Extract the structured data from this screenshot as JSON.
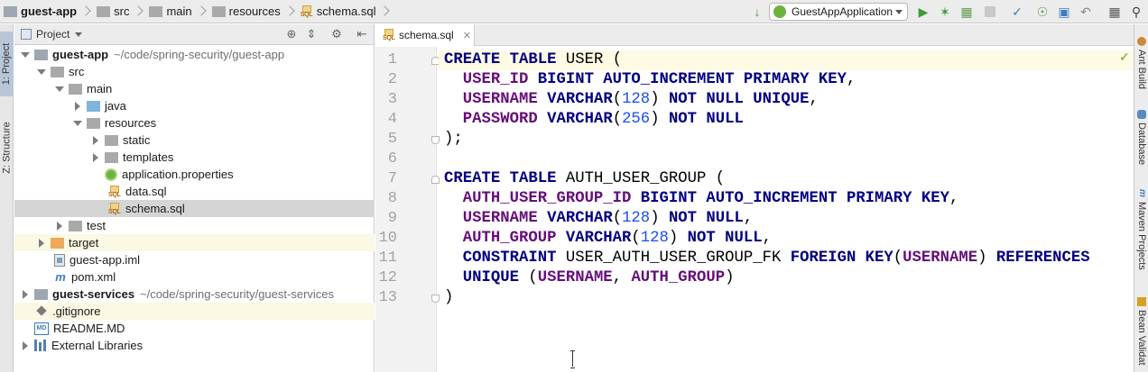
{
  "breadcrumb": {
    "items": [
      {
        "label": "guest-app",
        "icon": "module-folder-icon",
        "bold": true
      },
      {
        "label": "src",
        "icon": "folder-icon"
      },
      {
        "label": "main",
        "icon": "folder-icon"
      },
      {
        "label": "resources",
        "icon": "resources-folder-icon"
      },
      {
        "label": "schema.sql",
        "icon": "sql-file-icon"
      }
    ]
  },
  "toolbar": {
    "run_config": "GuestAppApplication",
    "icons": [
      "build-icon",
      "run-icon",
      "debug-icon",
      "coverage-icon",
      "stop-icon",
      "vcs-update-icon",
      "vcs-commit-icon",
      "vcs-compare-icon",
      "vcs-history-icon",
      "revert-icon",
      "project-structure-icon",
      "search-everywhere-icon"
    ]
  },
  "left_tool_strip": {
    "tabs": [
      {
        "label": "1: Project",
        "active": true
      },
      {
        "label": "Z: Structure",
        "active": false
      }
    ]
  },
  "project_panel": {
    "title": "Project",
    "tree": [
      {
        "label": "guest-app",
        "path": "~/code/spring-security/guest-app",
        "bold": true,
        "level": 0,
        "expanded": true,
        "icon": "module-folder-icon"
      },
      {
        "label": "src",
        "level": 1,
        "expanded": true,
        "icon": "folder-icon"
      },
      {
        "label": "main",
        "level": 2,
        "expanded": true,
        "icon": "folder-icon"
      },
      {
        "label": "java",
        "level": 3,
        "expanded": false,
        "icon": "source-folder-icon"
      },
      {
        "label": "resources",
        "level": 3,
        "expanded": true,
        "icon": "resources-folder-icon"
      },
      {
        "label": "static",
        "level": 4,
        "expanded": false,
        "icon": "folder-icon"
      },
      {
        "label": "templates",
        "level": 4,
        "expanded": false,
        "icon": "folder-icon"
      },
      {
        "label": "application.properties",
        "level": 4,
        "icon": "spring-properties-icon"
      },
      {
        "label": "data.sql",
        "level": 4,
        "icon": "sql-file-icon"
      },
      {
        "label": "schema.sql",
        "level": 4,
        "icon": "sql-file-icon",
        "selected": true
      },
      {
        "label": "test",
        "level": 2,
        "expanded": false,
        "icon": "folder-icon"
      },
      {
        "label": "target",
        "level": 1,
        "expanded": false,
        "icon": "excluded-folder-icon",
        "ignored": true
      },
      {
        "label": "guest-app.iml",
        "level": 1,
        "icon": "iml-file-icon"
      },
      {
        "label": "pom.xml",
        "level": 1,
        "icon": "maven-icon"
      },
      {
        "label": "guest-services",
        "path": "~/code/spring-security/guest-services",
        "bold": true,
        "level": 0,
        "expanded": false,
        "icon": "module-folder-icon"
      },
      {
        "label": ".gitignore",
        "level": 0,
        "icon": "gitignore-icon",
        "ignored": true
      },
      {
        "label": "README.MD",
        "level": 0,
        "icon": "markdown-icon"
      },
      {
        "label": "External Libraries",
        "level": 0,
        "expanded": false,
        "icon": "library-icon"
      }
    ]
  },
  "editor": {
    "tab_label": "schema.sql",
    "current_line": 1,
    "lines": [
      [
        [
          "kw",
          "CREATE TABLE "
        ],
        [
          "id",
          "USER "
        ],
        [
          "p",
          "("
        ]
      ],
      [
        [
          "p",
          "  "
        ],
        [
          "col",
          "USER_ID "
        ],
        [
          "kw",
          "BIGINT AUTO_INCREMENT PRIMARY KEY"
        ],
        [
          "p",
          ","
        ]
      ],
      [
        [
          "p",
          "  "
        ],
        [
          "col",
          "USERNAME "
        ],
        [
          "kw",
          "VARCHAR"
        ],
        [
          "p",
          "("
        ],
        [
          "num",
          "128"
        ],
        [
          "p",
          ") "
        ],
        [
          "kw",
          "NOT NULL UNIQUE"
        ],
        [
          "p",
          ","
        ]
      ],
      [
        [
          "p",
          "  "
        ],
        [
          "col",
          "PASSWORD "
        ],
        [
          "kw",
          "VARCHAR"
        ],
        [
          "p",
          "("
        ],
        [
          "num",
          "256"
        ],
        [
          "p",
          ") "
        ],
        [
          "kw",
          "NOT NULL"
        ]
      ],
      [
        [
          "p",
          ");"
        ]
      ],
      [],
      [
        [
          "kw",
          "CREATE TABLE "
        ],
        [
          "id",
          "AUTH_USER_GROUP "
        ],
        [
          "p",
          "("
        ]
      ],
      [
        [
          "p",
          "  "
        ],
        [
          "col",
          "AUTH_USER_GROUP_ID "
        ],
        [
          "kw",
          "BIGINT AUTO_INCREMENT PRIMARY KEY"
        ],
        [
          "p",
          ","
        ]
      ],
      [
        [
          "p",
          "  "
        ],
        [
          "col",
          "USERNAME "
        ],
        [
          "kw",
          "VARCHAR"
        ],
        [
          "p",
          "("
        ],
        [
          "num",
          "128"
        ],
        [
          "p",
          ") "
        ],
        [
          "kw",
          "NOT NULL"
        ],
        [
          "p",
          ","
        ]
      ],
      [
        [
          "p",
          "  "
        ],
        [
          "col",
          "AUTH_GROUP "
        ],
        [
          "kw",
          "VARCHAR"
        ],
        [
          "p",
          "("
        ],
        [
          "num",
          "128"
        ],
        [
          "p",
          ") "
        ],
        [
          "kw",
          "NOT NULL"
        ],
        [
          "p",
          ","
        ]
      ],
      [
        [
          "p",
          "  "
        ],
        [
          "kw",
          "CONSTRAINT "
        ],
        [
          "id",
          "USER_AUTH_USER_GROUP_FK "
        ],
        [
          "kw",
          "FOREIGN KEY"
        ],
        [
          "p",
          "("
        ],
        [
          "col",
          "USERNAME"
        ],
        [
          "p",
          ") "
        ],
        [
          "kw",
          "REFERENCES"
        ]
      ],
      [
        [
          "p",
          "  "
        ],
        [
          "kw",
          "UNIQUE "
        ],
        [
          "p",
          "("
        ],
        [
          "col",
          "USERNAME"
        ],
        [
          "p",
          ", "
        ],
        [
          "col",
          "AUTH_GROUP"
        ],
        [
          "p",
          ")"
        ]
      ],
      [
        [
          "p",
          ")"
        ]
      ]
    ]
  },
  "right_tool_strip": {
    "tabs": [
      "Ant Build",
      "Database",
      "Maven Projects",
      "Bean Validat"
    ]
  },
  "colors": {
    "keyword": "#000080",
    "column": "#660e7a",
    "number": "#1750eb",
    "selection": "#d5d5d5",
    "current_line": "#fefae3"
  }
}
